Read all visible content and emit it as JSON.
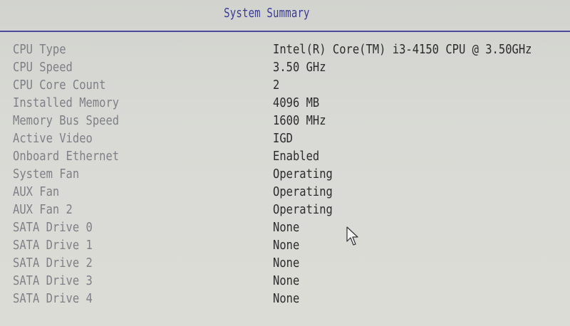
{
  "header": {
    "title": "System Summary"
  },
  "summary": {
    "rows": [
      {
        "label": "CPU Type",
        "value": "Intel(R) Core(TM) i3-4150 CPU @ 3.50GHz"
      },
      {
        "label": "CPU Speed",
        "value": "3.50 GHz"
      },
      {
        "label": "CPU Core Count",
        "value": "2"
      },
      {
        "label": "Installed Memory",
        "value": "4096 MB"
      },
      {
        "label": "Memory Bus Speed",
        "value": "1600 MHz"
      },
      {
        "label": "Active Video",
        "value": "IGD"
      },
      {
        "label": "Onboard Ethernet",
        "value": "Enabled"
      },
      {
        "label": "System Fan",
        "value": "Operating"
      },
      {
        "label": "AUX Fan",
        "value": "Operating"
      },
      {
        "label": "AUX Fan 2",
        "value": "Operating"
      },
      {
        "label": "SATA Drive 0",
        "value": "None"
      },
      {
        "label": "SATA Drive 1",
        "value": "None"
      },
      {
        "label": "SATA Drive 2",
        "value": "None"
      },
      {
        "label": "SATA Drive 3",
        "value": "None"
      },
      {
        "label": "SATA Drive 4",
        "value": "None"
      }
    ]
  },
  "colors": {
    "title": "#3a3a96",
    "label": "#7f7f87",
    "value": "#2c2c2c",
    "background": "#d6d7d2"
  },
  "icons": {
    "pointer": "mouse-pointer-icon"
  }
}
